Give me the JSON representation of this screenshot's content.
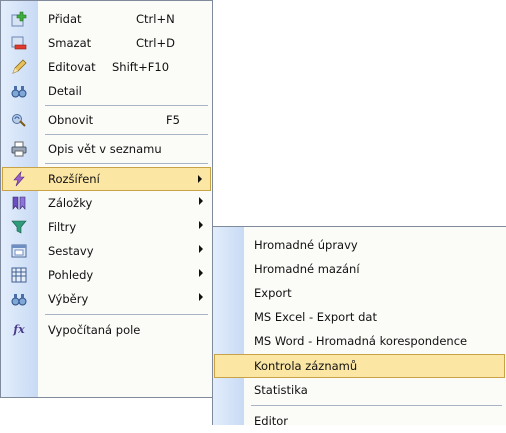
{
  "main_menu": {
    "items": [
      {
        "label": "Přidat",
        "shortcut": "Ctrl+N",
        "icon": "add-green-plus-icon"
      },
      {
        "label": "Smazat",
        "shortcut": "Ctrl+D",
        "icon": "delete-red-minus-icon"
      },
      {
        "label": "Editovat",
        "shortcut": "Shift+F10",
        "icon": "edit-pencil-icon"
      },
      {
        "label": "Detail",
        "icon": "binoculars-icon"
      },
      {
        "label": "Obnovit",
        "shortcut": "F5",
        "icon": "refresh-icon"
      },
      {
        "label": "Opis vět v seznamu",
        "icon": "printer-icon"
      },
      {
        "label": "Rozšíření",
        "icon": "lightning-icon",
        "has_submenu": true,
        "highlighted": true
      },
      {
        "label": "Záložky",
        "icon": "bookmarks-icon",
        "has_submenu": true
      },
      {
        "label": "Filtry",
        "icon": "filter-funnel-icon",
        "has_submenu": true
      },
      {
        "label": "Sestavy",
        "icon": "report-icon",
        "has_submenu": true
      },
      {
        "label": "Pohledy",
        "icon": "grid-view-icon",
        "has_submenu": true
      },
      {
        "label": "Výběry",
        "icon": "binoculars-icon",
        "has_submenu": true
      },
      {
        "label": "Vypočítaná pole",
        "icon": "function-fx-icon"
      }
    ]
  },
  "sub_menu": {
    "items": [
      {
        "label": "Hromadné úpravy"
      },
      {
        "label": "Hromadné mazání"
      },
      {
        "label": "Export"
      },
      {
        "label": "MS Excel - Export dat"
      },
      {
        "label": "MS Word - Hromadná korespondence"
      },
      {
        "label": "Kontrola záznamů",
        "highlighted": true
      },
      {
        "label": "Statistika"
      },
      {
        "label": "Editor"
      }
    ]
  },
  "colors": {
    "highlight_bg": "#fbe6a4",
    "highlight_border": "#c8a247",
    "gutter_start": "#e3eefc",
    "gutter_end": "#c8daf4"
  }
}
